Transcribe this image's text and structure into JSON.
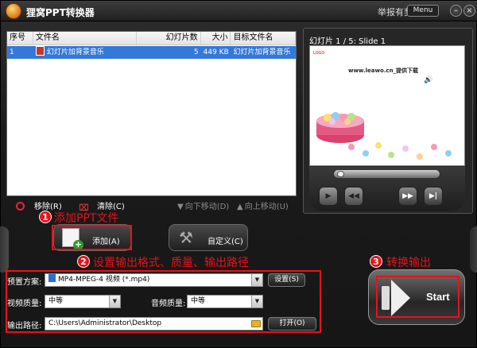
{
  "app": {
    "title": "狸窝PPT转换器",
    "report_label": "举报有奖",
    "menu_label": "Menu",
    "minimize_glyph": "–",
    "close_glyph": "×"
  },
  "file_table": {
    "columns": [
      "序号",
      "文件名",
      "幻灯片数",
      "大小",
      "目标文件名"
    ],
    "rows": [
      {
        "index": "1",
        "name": "幻灯片加背景音乐",
        "slides": "5",
        "size": "449 KB",
        "target": "幻灯片加背景音乐"
      }
    ]
  },
  "list_toolbar": {
    "remove": "移除(R)",
    "clear": "清除(C)",
    "move_down": "向下移动(D)",
    "move_up": "向上移动(U)"
  },
  "preview": {
    "caption": "幻灯片 1 / 5: Slide 1",
    "slide_logo": "LOGO",
    "slide_url": "www.leawo.cn_提供下载",
    "controls": [
      "previous-icon",
      "rewind-icon",
      "forward-icon",
      "next-icon"
    ]
  },
  "actions": {
    "add_label": "添加(A)",
    "custom_label": "自定义(C)"
  },
  "annotations": {
    "step1_number": "1",
    "step1_text": "添加PPT文件",
    "step2_number": "2",
    "step2_text": "设置输出格式、质量、输出路径",
    "step3_number": "3",
    "step3_text": "转换输出",
    "color": "#e8121a"
  },
  "settings": {
    "preset_label": "预置方案:",
    "preset_value": "MP4-MPEG-4 视频 (*.mp4)",
    "settings_button": "设置(S)",
    "video_quality_label": "视频质量:",
    "video_quality_value": "中等",
    "audio_quality_label": "音频质量:",
    "audio_quality_value": "中等",
    "output_path_label": "输出路径:",
    "output_path_value": "C:\\Users\\Administrator\\Desktop",
    "open_button": "打开(O)"
  },
  "start": {
    "label": "Start"
  },
  "colors": {
    "selection": "#3478d8",
    "background": "#1a1a1a"
  }
}
